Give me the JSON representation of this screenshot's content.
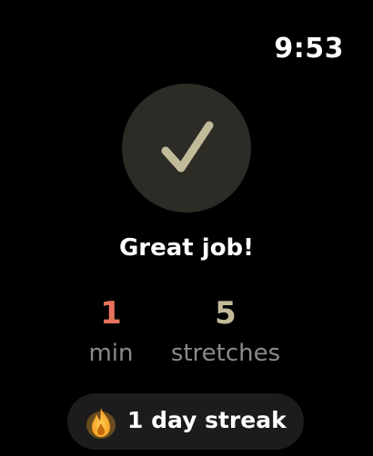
{
  "status_bar": {
    "time": "9:53"
  },
  "completion": {
    "icon": "checkmark-icon",
    "headline": "Great job!"
  },
  "stats": {
    "minutes": {
      "value": "1",
      "unit": "min"
    },
    "stretches": {
      "value": "5",
      "unit": "stretches"
    }
  },
  "streak": {
    "icon": "flame-icon",
    "label": "1 day streak"
  },
  "colors": {
    "background": "#000000",
    "check_circle": "#2d2b26",
    "checkmark": "#c2bb9a",
    "minutes_accent": "#e9735e",
    "stretches_accent": "#c2bb9a",
    "unit_text": "#8a8a8a",
    "streak_pill": "#1c1c1c",
    "flame": "#f5a623"
  }
}
